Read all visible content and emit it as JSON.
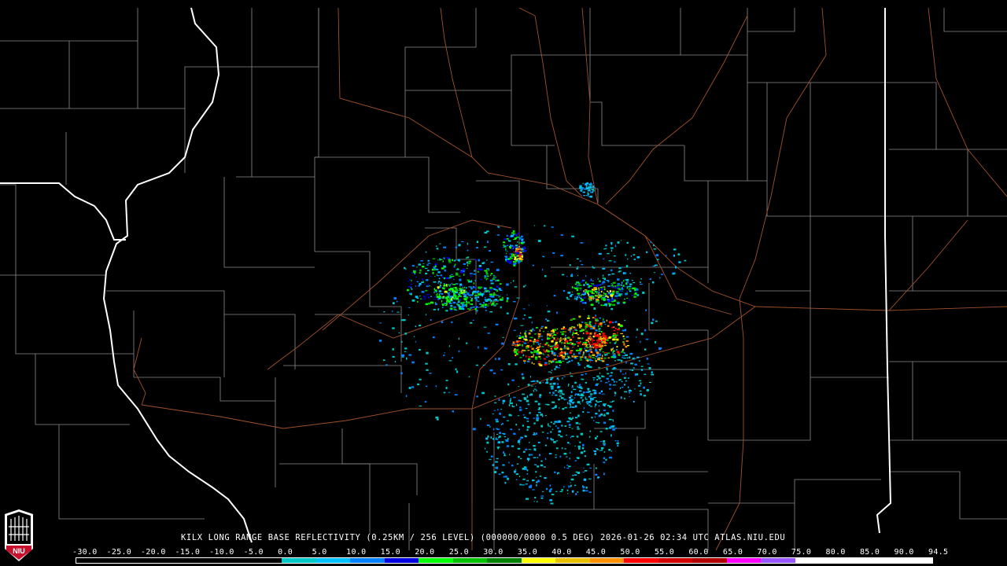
{
  "title": "KILX LONG RANGE BASE REFLECTIVITY (0.25KM / 256 LEVEL) (000000/0000 0.5 DEG) 2026-01-26 02:34 UTC  ATLAS.NIU.EDU",
  "logo_text": "NIU",
  "scale": {
    "labels": [
      "-30.0",
      "-25.0",
      "-20.0",
      "-15.0",
      "-10.0",
      "-5.0",
      "0.0",
      "5.0",
      "10.0",
      "15.0",
      "20.0",
      "25.0",
      "30.0",
      "35.0",
      "40.0",
      "45.0",
      "50.0",
      "55.0",
      "60.0",
      "65.0",
      "70.0",
      "75.0",
      "80.0",
      "85.0",
      "90.0",
      "94.5"
    ],
    "colors": [
      "#000000",
      "#000000",
      "#000000",
      "#000000",
      "#000000",
      "#000000",
      "#00c8c8",
      "#00c0ff",
      "#0080ff",
      "#0000e0",
      "#00ff00",
      "#00c000",
      "#008000",
      "#ffff00",
      "#e8c000",
      "#ff9000",
      "#ff0000",
      "#d00000",
      "#b00000",
      "#ff00ff",
      "#9955ff",
      "#ffffff",
      "#ffffff",
      "#ffffff",
      "#ffffff"
    ]
  },
  "colors": {
    "background": "#000000",
    "county_lines": "#9a9a9a",
    "state_lines": "#ffffff",
    "roads": "#a0522d"
  }
}
